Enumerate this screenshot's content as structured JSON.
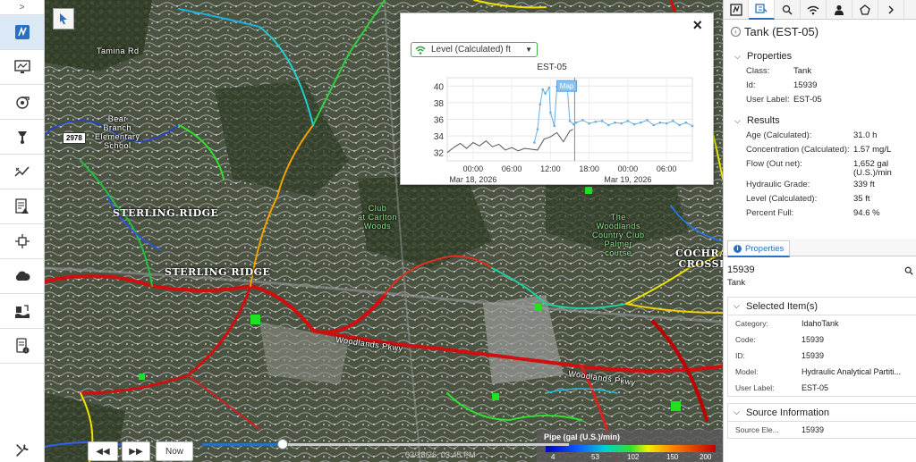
{
  "toolbar": {
    "collapse_glyph": ">",
    "items": [
      {
        "name": "tool-network-icon",
        "active": true
      },
      {
        "name": "tool-monitor-icon"
      },
      {
        "name": "tool-pump-icon"
      },
      {
        "name": "tool-valve-icon"
      },
      {
        "name": "tool-trend-icon"
      },
      {
        "name": "tool-report-alert-icon"
      },
      {
        "name": "tool-connection-icon"
      },
      {
        "name": "tool-cloud-icon"
      },
      {
        "name": "tool-flood-icon"
      },
      {
        "name": "tool-device-info-icon"
      }
    ],
    "bottom_icon": "tools-icon"
  },
  "map": {
    "labels": {
      "sterling_ridge_1": "STERLING RIDGE",
      "sterling_ridge_2": "STERLING RIDGE",
      "cochran_crossing": "COCHRAN\nCROSSIN",
      "club_carlton": "Club\nat Carlton\nWoods",
      "woodlands_country_club": "The\nWoodlands\nCountry Club\nPalmer\ncourse",
      "bear_branch": "Bear\nBranch\nElementary\nSchool",
      "tamina": "Tamina Rd",
      "woodlands_pkwy_1": "Woodlands Pkwy",
      "woodlands_pkwy_2": "Woodlands Pkwy",
      "shield_2978": "2978"
    }
  },
  "chart_popup": {
    "close_glyph": "×",
    "attribute_select": "Level (Calculated) ft",
    "map_tag": "Map"
  },
  "chart_data": {
    "type": "line",
    "title": "EST-05",
    "ylim": [
      31,
      41
    ],
    "yticks": [
      32,
      34,
      36,
      38,
      40
    ],
    "x_tick_labels": [
      "00:00",
      "06:00",
      "12:00",
      "18:00",
      "00:00",
      "06:00"
    ],
    "x_date_labels": [
      {
        "at": 0,
        "label": "Mar 18, 2026"
      },
      {
        "at": 4,
        "label": "Mar 19, 2026"
      }
    ],
    "hours_range": [
      -4,
      34
    ],
    "current_time_hour": 15.75,
    "series": [
      {
        "color": "#6aaee0",
        "x": [
          9.5,
          10.0,
          10.4,
          10.8,
          11.2,
          11.8,
          12.0,
          12.6,
          13.0,
          13.6,
          14.0,
          14.6,
          15.0,
          15.6,
          16.0,
          17.0,
          18.0,
          19.0,
          20.0,
          21.0,
          22.0,
          23.0,
          24.0,
          25.0,
          26.0,
          27.0,
          28.0,
          29.0,
          30.0,
          31.0,
          32.0,
          33.0,
          34.0
        ],
        "y": [
          33.2,
          34.8,
          37.8,
          39.6,
          39.1,
          39.8,
          36.8,
          35.2,
          39.9,
          39.9,
          39.9,
          39.9,
          35.8,
          35.4,
          35.6,
          35.9,
          35.5,
          35.7,
          35.8,
          35.3,
          35.6,
          35.5,
          35.8,
          35.4,
          35.6,
          35.9,
          35.3,
          35.6,
          35.5,
          35.8,
          35.3,
          35.6,
          35.2
        ]
      },
      {
        "color": "#555555",
        "x": [
          -4,
          -3,
          -2,
          -1,
          0,
          1,
          2,
          3,
          4,
          5,
          6,
          7,
          8,
          9,
          10,
          11,
          12,
          13,
          14,
          15,
          15.5
        ],
        "y": [
          32.0,
          32.6,
          33.1,
          32.5,
          33.2,
          32.8,
          33.4,
          32.7,
          33.0,
          32.3,
          32.6,
          32.2,
          32.5,
          32.4,
          32.3,
          33.6,
          33.9,
          34.4,
          33.3,
          34.6,
          34.8
        ]
      }
    ]
  },
  "timeline": {
    "rewind_glyph": "◀◀",
    "forward_glyph": "▶▶",
    "now_label": "Now",
    "progress": 0.22,
    "time_text": "03/18/26, 03:45 PM"
  },
  "legend": {
    "title": "Pipe (gal (U.S.)/min)",
    "ticks": [
      "4",
      "53",
      "102",
      "150",
      "200"
    ]
  },
  "right_panel": {
    "header_title": "Tank (EST-05)",
    "properties_title": "Properties",
    "properties": [
      {
        "k": "Class:",
        "v": "Tank"
      },
      {
        "k": "Id:",
        "v": "15939"
      },
      {
        "k": "User Label:",
        "v": "EST-05"
      }
    ],
    "results_title": "Results",
    "results": [
      {
        "k": "Age (Calculated):",
        "v": "31.0 h"
      },
      {
        "k": "Concentration (Calculated):",
        "v": "1.57 mg/L"
      },
      {
        "k": "Flow (Out net):",
        "v": "1,652 gal (U.S.)/min"
      },
      {
        "k": "Hydraulic Grade:",
        "v": "339 ft"
      },
      {
        "k": "Level (Calculated):",
        "v": "35 ft"
      },
      {
        "k": "Percent Full:",
        "v": "94.6 %"
      }
    ],
    "props_tab_label": "Properties",
    "id_value": "15939",
    "class_value": "Tank",
    "selected_title": "Selected Item(s)",
    "selected": [
      {
        "k": "Category:",
        "v": "IdahoTank"
      },
      {
        "k": "Code:",
        "v": "15939"
      },
      {
        "k": "ID:",
        "v": "15939"
      },
      {
        "k": "Model:",
        "v": "Hydraulic Analytical Partiti..."
      },
      {
        "k": "User Label:",
        "v": "EST-05"
      }
    ],
    "source_title": "Source Information",
    "source": [
      {
        "k": "Source Ele...",
        "v": "15939"
      }
    ]
  }
}
